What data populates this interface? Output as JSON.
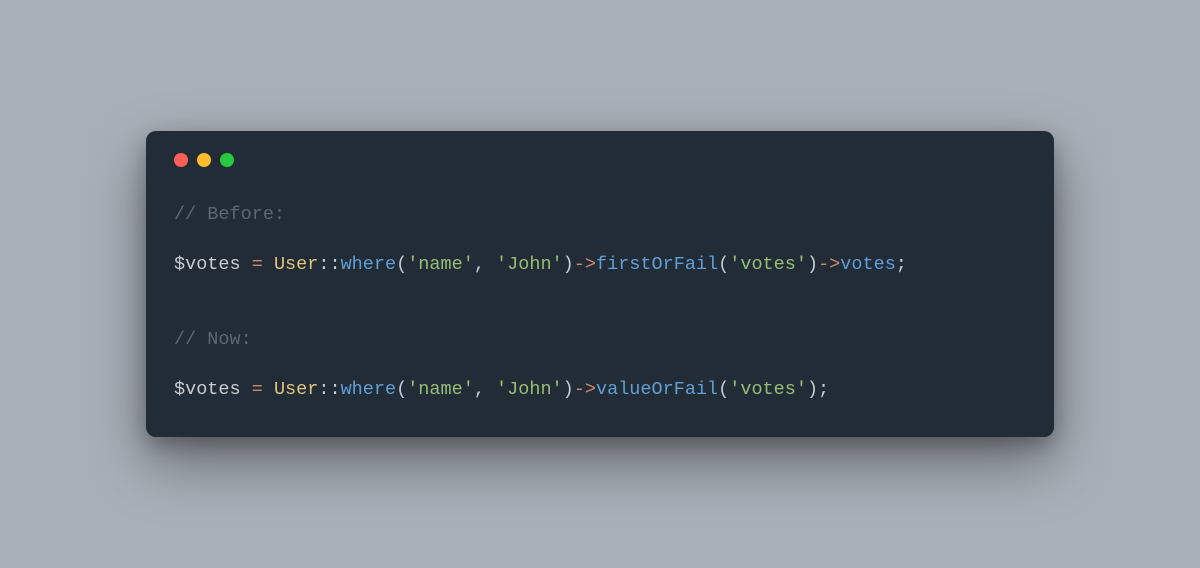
{
  "colors": {
    "page_bg": "#a9b0b9",
    "window_bg": "#222c37",
    "traffic_red": "#ff5f56",
    "traffic_yellow": "#ffbd2e",
    "traffic_green": "#27c93f",
    "comment": "#5c6773",
    "punct": "#c7ccd1",
    "var": "#c7ccd1",
    "op": "#cf8a6b",
    "class": "#e0c47a",
    "func": "#5f9fd6",
    "string": "#97bd76",
    "prop": "#5f9fd6"
  },
  "code": {
    "lines": [
      [
        {
          "cls": "tok-comment",
          "text": "// Before:"
        }
      ],
      [],
      [
        {
          "cls": "tok-var",
          "text": "$votes "
        },
        {
          "cls": "tok-op",
          "text": "="
        },
        {
          "cls": "tok-var",
          "text": " "
        },
        {
          "cls": "tok-class",
          "text": "User"
        },
        {
          "cls": "tok-punct",
          "text": "::"
        },
        {
          "cls": "tok-func",
          "text": "where"
        },
        {
          "cls": "tok-punct",
          "text": "("
        },
        {
          "cls": "tok-string",
          "text": "'name'"
        },
        {
          "cls": "tok-punct",
          "text": ", "
        },
        {
          "cls": "tok-string",
          "text": "'John'"
        },
        {
          "cls": "tok-punct",
          "text": ")"
        },
        {
          "cls": "tok-op",
          "text": "->"
        },
        {
          "cls": "tok-func",
          "text": "firstOrFail"
        },
        {
          "cls": "tok-punct",
          "text": "("
        },
        {
          "cls": "tok-string",
          "text": "'votes'"
        },
        {
          "cls": "tok-punct",
          "text": ")"
        },
        {
          "cls": "tok-op",
          "text": "->"
        },
        {
          "cls": "tok-prop",
          "text": "votes"
        },
        {
          "cls": "tok-punct",
          "text": ";"
        }
      ],
      [],
      [],
      [
        {
          "cls": "tok-comment",
          "text": "// Now:"
        }
      ],
      [],
      [
        {
          "cls": "tok-var",
          "text": "$votes "
        },
        {
          "cls": "tok-op",
          "text": "="
        },
        {
          "cls": "tok-var",
          "text": " "
        },
        {
          "cls": "tok-class",
          "text": "User"
        },
        {
          "cls": "tok-punct",
          "text": "::"
        },
        {
          "cls": "tok-func",
          "text": "where"
        },
        {
          "cls": "tok-punct",
          "text": "("
        },
        {
          "cls": "tok-string",
          "text": "'name'"
        },
        {
          "cls": "tok-punct",
          "text": ", "
        },
        {
          "cls": "tok-string",
          "text": "'John'"
        },
        {
          "cls": "tok-punct",
          "text": ")"
        },
        {
          "cls": "tok-op",
          "text": "->"
        },
        {
          "cls": "tok-func",
          "text": "valueOrFail"
        },
        {
          "cls": "tok-punct",
          "text": "("
        },
        {
          "cls": "tok-string",
          "text": "'votes'"
        },
        {
          "cls": "tok-punct",
          "text": ");"
        }
      ]
    ]
  }
}
